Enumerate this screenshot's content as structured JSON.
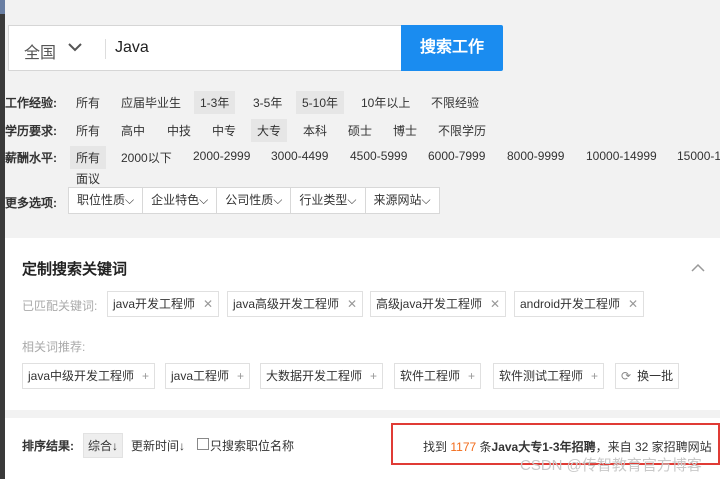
{
  "search": {
    "city": "全国",
    "keyword": "Java",
    "button_label": "搜索工作"
  },
  "filters": {
    "experience": {
      "label": "工作经验:",
      "options": [
        "所有",
        "应届毕业生",
        "1-3年",
        "3-5年",
        "5-10年",
        "10年以上",
        "不限经验"
      ],
      "selected": [
        "1-3年",
        "5-10年"
      ]
    },
    "education": {
      "label": "学历要求:",
      "options": [
        "所有",
        "高中",
        "中技",
        "中专",
        "大专",
        "本科",
        "硕士",
        "博士",
        "不限学历"
      ],
      "selected": [
        "大专"
      ]
    },
    "salary": {
      "label": "薪酬水平:",
      "options": [
        "所有",
        "2000以下",
        "2000-2999",
        "3000-4499",
        "4500-5999",
        "6000-7999",
        "8000-9999",
        "10000-14999",
        "15000-1"
      ],
      "extra_option": "面议",
      "selected": [
        "所有"
      ]
    },
    "more": {
      "label": "更多选项:",
      "dropdowns": [
        "职位性质",
        "企业特色",
        "公司性质",
        "行业类型",
        "来源网站"
      ]
    }
  },
  "custom_keywords": {
    "title": "定制搜索关键词",
    "matched_label": "已匹配关键词:",
    "matched": [
      "java开发工程师",
      "java高级开发工程师",
      "高级java开发工程师",
      "android开发工程师"
    ],
    "related_label": "相关词推荐:",
    "related": [
      "java中级开发工程师",
      "java工程师",
      "大数据开发工程师",
      "软件工程师",
      "软件测试工程师"
    ],
    "refresh_label": "换一批"
  },
  "sort": {
    "label": "排序结果:",
    "comprehensive": "综合",
    "update_time": "更新时间",
    "only_title": "只搜索职位名称"
  },
  "result": {
    "prefix": "找到",
    "count": "1177",
    "middle": "条",
    "query": "Java大专1-3年招聘",
    "from": "，来自",
    "sites": "32",
    "suffix": "家招聘网站"
  },
  "watermark": "CSDN @传智教育官方博客",
  "colors": {
    "primary": "#1a8cf0",
    "highlight_border": "#e03b35",
    "count": "#f26b1a"
  },
  "icons": [
    "chevron-down-icon",
    "close-icon",
    "plus-icon",
    "refresh-icon",
    "chevron-up-icon",
    "sort-arrow-icon"
  ]
}
